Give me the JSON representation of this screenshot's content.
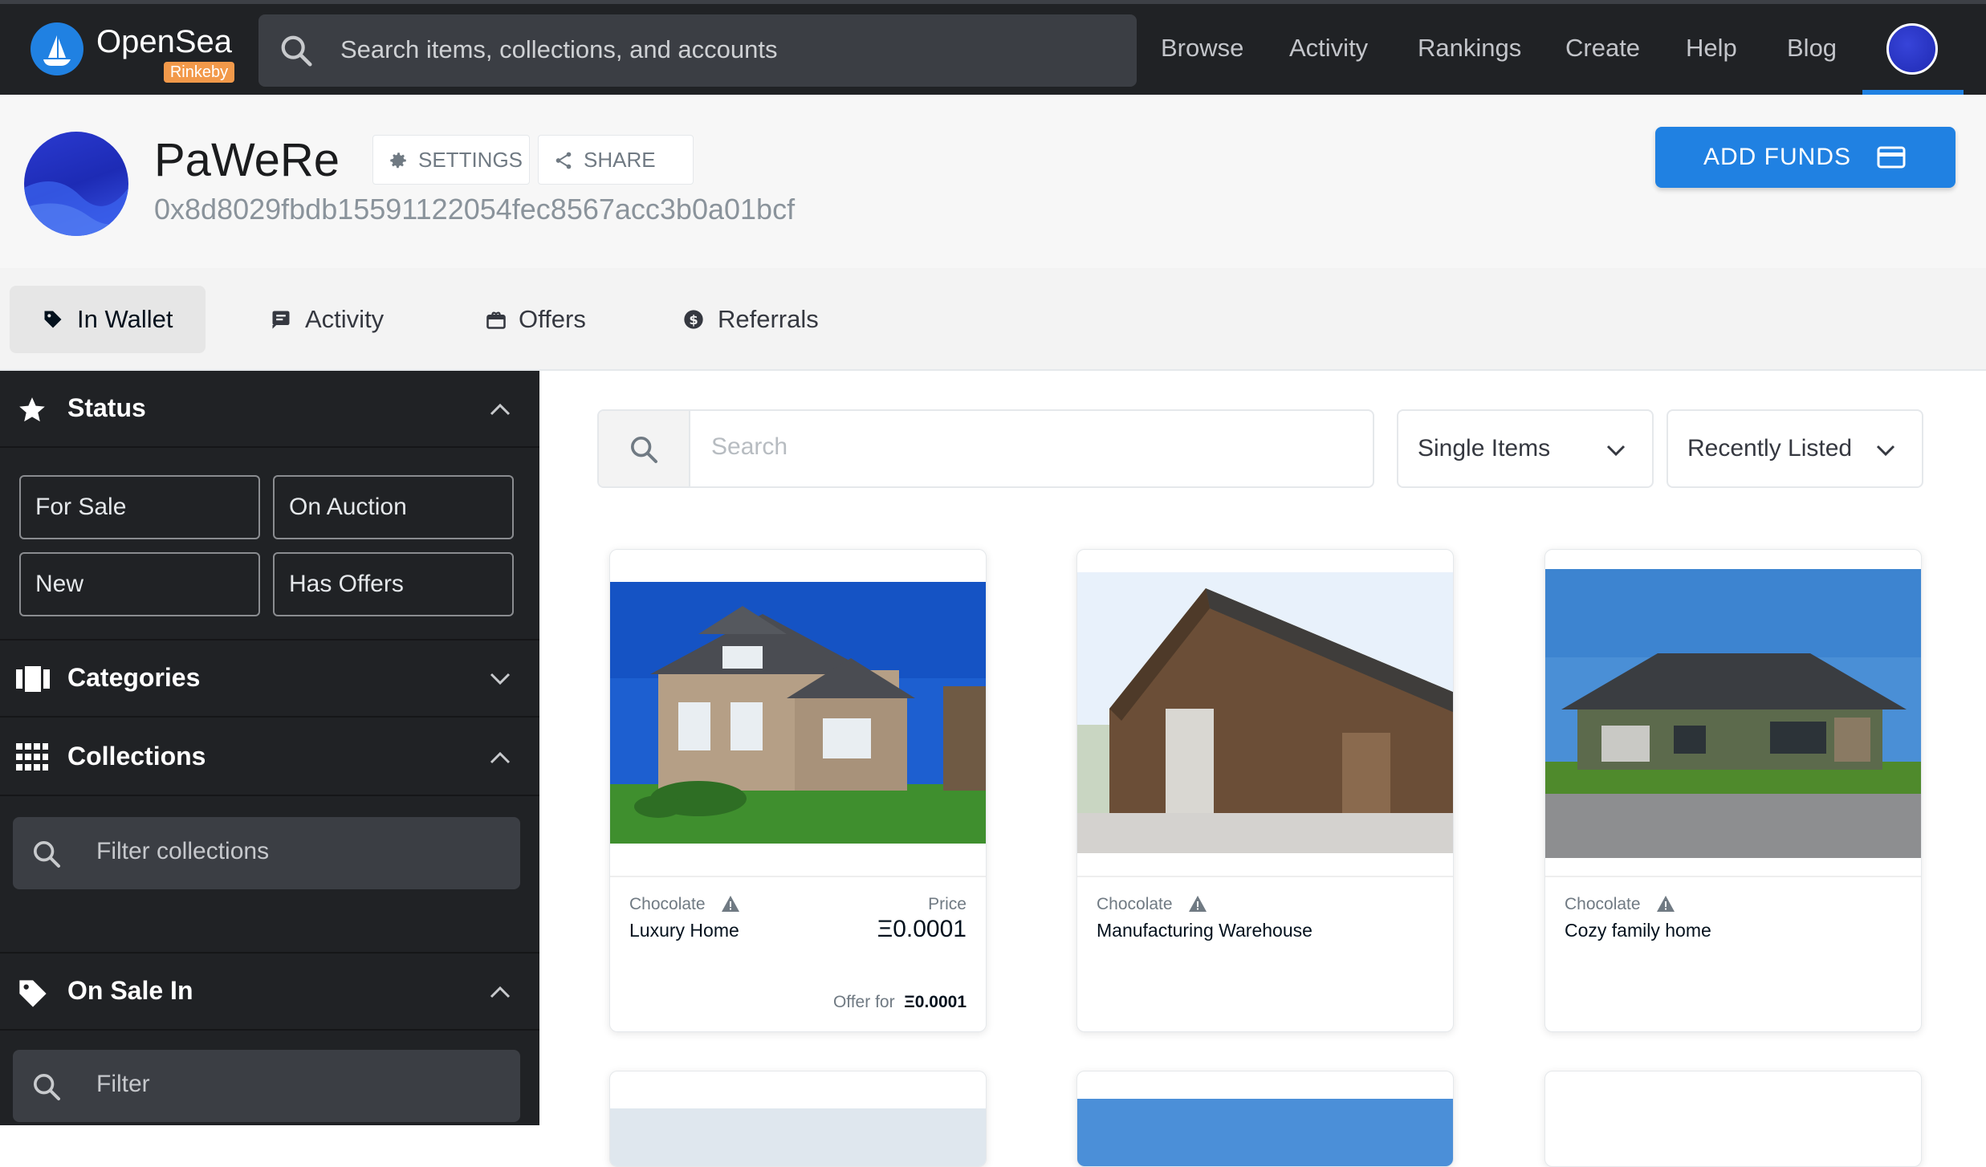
{
  "brand": {
    "name": "OpenSea",
    "network_badge": "Rinkeby"
  },
  "nav": {
    "search_placeholder": "Search items, collections, and accounts",
    "links": [
      "Browse",
      "Activity",
      "Rankings",
      "Create",
      "Help",
      "Blog"
    ]
  },
  "profile": {
    "name": "PaWeRe",
    "address": "0x8d8029fbdb15591122054fec8567acc3b0a01bcf",
    "settings_label": "SETTINGS",
    "share_label": "SHARE",
    "add_funds_label": "ADD FUNDS"
  },
  "tabs": [
    {
      "label": "In Wallet",
      "active": true
    },
    {
      "label": "Activity",
      "active": false
    },
    {
      "label": "Offers",
      "active": false
    },
    {
      "label": "Referrals",
      "active": false
    }
  ],
  "sidebar": {
    "status": {
      "title": "Status",
      "chips": [
        "For Sale",
        "On Auction",
        "New",
        "Has Offers"
      ]
    },
    "categories": {
      "title": "Categories"
    },
    "collections": {
      "title": "Collections",
      "filter_placeholder": "Filter collections"
    },
    "on_sale_in": {
      "title": "On Sale In",
      "filter_placeholder": "Filter"
    }
  },
  "main": {
    "search_placeholder": "Search",
    "item_type": "Single Items",
    "sort": "Recently Listed"
  },
  "assets": [
    {
      "collection": "Chocolate",
      "name": "Luxury Home",
      "price_label": "Price",
      "price": "Ξ0.0001",
      "offer_label": "Offer for",
      "offer": "Ξ0.0001"
    },
    {
      "collection": "Chocolate",
      "name": "Manufacturing Warehouse"
    },
    {
      "collection": "Chocolate",
      "name": "Cozy family home"
    }
  ],
  "colors": {
    "accent": "#2081e2",
    "nav_bg": "#202225",
    "sidebar_bg": "#202225",
    "badge": "#f2994a"
  }
}
